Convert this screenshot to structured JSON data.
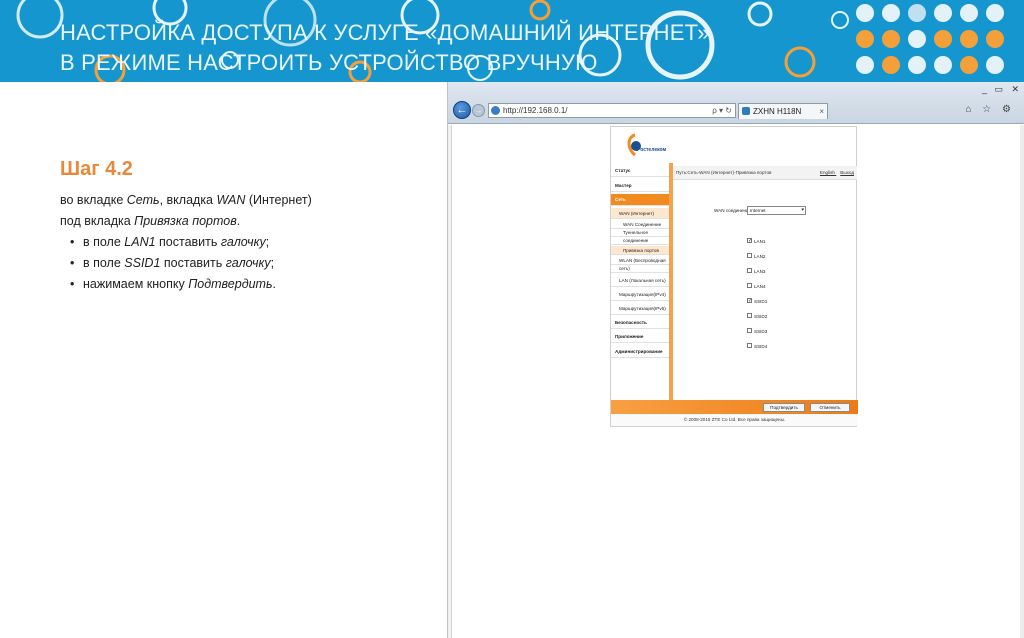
{
  "banner": {
    "title_line1": "НАСТРОЙКА ДОСТУПА К УСЛУГЕ «ДОМАШНИЙ ИНТЕРНЕТ»",
    "title_line2": "В РЕЖИМЕ НАСТРОИТЬ УСТРОЙСТВО ВРУЧНУЮ",
    "colors": {
      "background": "#1696cf",
      "accent_orange": "#f4a03a",
      "accent_light": "#e3f1f8"
    }
  },
  "step": {
    "title": "Шаг 4.2",
    "line1_pre": "во вкладке ",
    "line1_em1": "Сеть",
    "line1_mid": ", вкладка ",
    "line1_em2": "WAN",
    "line1_post": " (Интернет)",
    "line2_pre": "под вкладка ",
    "line2_em": "Привязка портов",
    "line2_post": ".",
    "bullets": [
      {
        "pre": "в поле ",
        "em1": "LAN1",
        "mid": " поставить ",
        "em2": "галочку",
        "post": ";"
      },
      {
        "pre": "в поле ",
        "em1": "SSID1",
        "mid": " поставить ",
        "em2": "галочку",
        "post": ";"
      },
      {
        "pre": "нажимаем кнопку ",
        "em1": "Подтвердить",
        "mid": "",
        "em2": "",
        "post": "."
      }
    ]
  },
  "browser": {
    "window_controls": [
      "_",
      "▭",
      "✕"
    ],
    "back_icon": "←",
    "forward_icon": "→",
    "address": "http://192.168.0.1/",
    "address_controls": "ρ ▾ ↻",
    "tab_title": "ZXHN H118N",
    "tab_close": "×",
    "tools": "⌂ ☆ ⚙"
  },
  "router": {
    "brand": "Ростелеком",
    "nav": [
      {
        "label": "Статус",
        "style": "bold"
      },
      {
        "label": "Мастер",
        "style": "bold"
      },
      {
        "label": "Сеть",
        "style": "active"
      },
      {
        "label": "WAN (Интернет)",
        "style": "sub sel"
      },
      {
        "label": "WAN Соединение",
        "style": "sub2"
      },
      {
        "label": "Туннельное",
        "style": "sub2"
      },
      {
        "label": "соединение",
        "style": "sub2"
      },
      {
        "label": "Привязка портов",
        "style": "sub2 sel"
      },
      {
        "label": "WLAN (Беспроводная",
        "style": "sub"
      },
      {
        "label": "сеть)",
        "style": "sub"
      },
      {
        "label": "LAN (Локальная сеть)",
        "style": "sub"
      },
      {
        "label": "Маршрутизация(IPv4)",
        "style": "sub"
      },
      {
        "label": "Маршрутизация(IPv6)",
        "style": "sub"
      },
      {
        "label": "Безопасность",
        "style": "bold"
      },
      {
        "label": "Приложение",
        "style": "bold"
      },
      {
        "label": "Администрирование",
        "style": "bold"
      }
    ],
    "breadcrumb": "Путь:Сеть-WAN (Интернет)-Привязка портов",
    "link_english": "English",
    "link_logout": "Выход",
    "wan_label": "WAN соединение",
    "wan_value": "Internet",
    "ports": [
      {
        "label": "LAN1",
        "checked": true
      },
      {
        "label": "LAN2",
        "checked": false
      },
      {
        "label": "LAN3",
        "checked": false
      },
      {
        "label": "LAN4",
        "checked": false
      },
      {
        "label": "SSID1",
        "checked": true
      },
      {
        "label": "SSID2",
        "checked": false
      },
      {
        "label": "SSID3",
        "checked": false
      },
      {
        "label": "SSID4",
        "checked": false
      }
    ],
    "confirm_label": "Подтвердить",
    "cancel_label": "Отменить",
    "copyright": "© 2008-2015 ZTE Co Ltd. Все права защищены."
  }
}
